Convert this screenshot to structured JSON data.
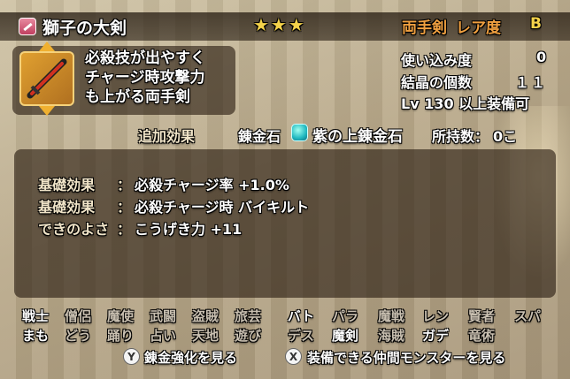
{
  "item": {
    "name": "獅子の大剣",
    "stars": "★★★",
    "type": "両手剣",
    "rarity_label": "レア度",
    "rarity_value": "B",
    "description": [
      "必殺技が出やすく",
      "チャージ時攻撃力",
      "も上がる両手剣"
    ]
  },
  "stats": {
    "usage_label": "使い込み度",
    "usage_value": "0",
    "crystals_label": "結晶の個数",
    "crystals_value": "１１",
    "level_label": "Lv 130 以上装備可"
  },
  "alchemy": {
    "extra_effects_label": "追加効果",
    "stone_label": "錬金石",
    "stone_name": "紫の上錬金石",
    "owned_label": "所持数：",
    "owned_value": "0こ"
  },
  "effects": [
    {
      "label": "基礎効果",
      "value": "必殺チャージ率 +1.0%"
    },
    {
      "label": "基礎効果",
      "value": "必殺チャージ時 バイキルト"
    },
    {
      "label": "できのよさ",
      "value": "こうげき力 +11"
    }
  ],
  "jobs_row1": [
    "戦士",
    "僧侶",
    "魔使",
    "武闘",
    "盗賊",
    "旅芸",
    "バト",
    "パラ",
    "魔戦",
    "レン",
    "賢者",
    "スパ"
  ],
  "jobs_row2": [
    "まも",
    "どう",
    "踊り",
    "占い",
    "天地",
    "遊び",
    "デス",
    "魔剣",
    "海賊",
    "ガデ",
    "竜術"
  ],
  "buttons": {
    "y_key": "Y",
    "y_label": "錬金強化を見る",
    "x_key": "X",
    "x_label": "装備できる仲間モンスターを見る"
  },
  "colors": {
    "accent": "#f0a040",
    "star": "#f4d24a",
    "gem": "#20b8c0"
  }
}
